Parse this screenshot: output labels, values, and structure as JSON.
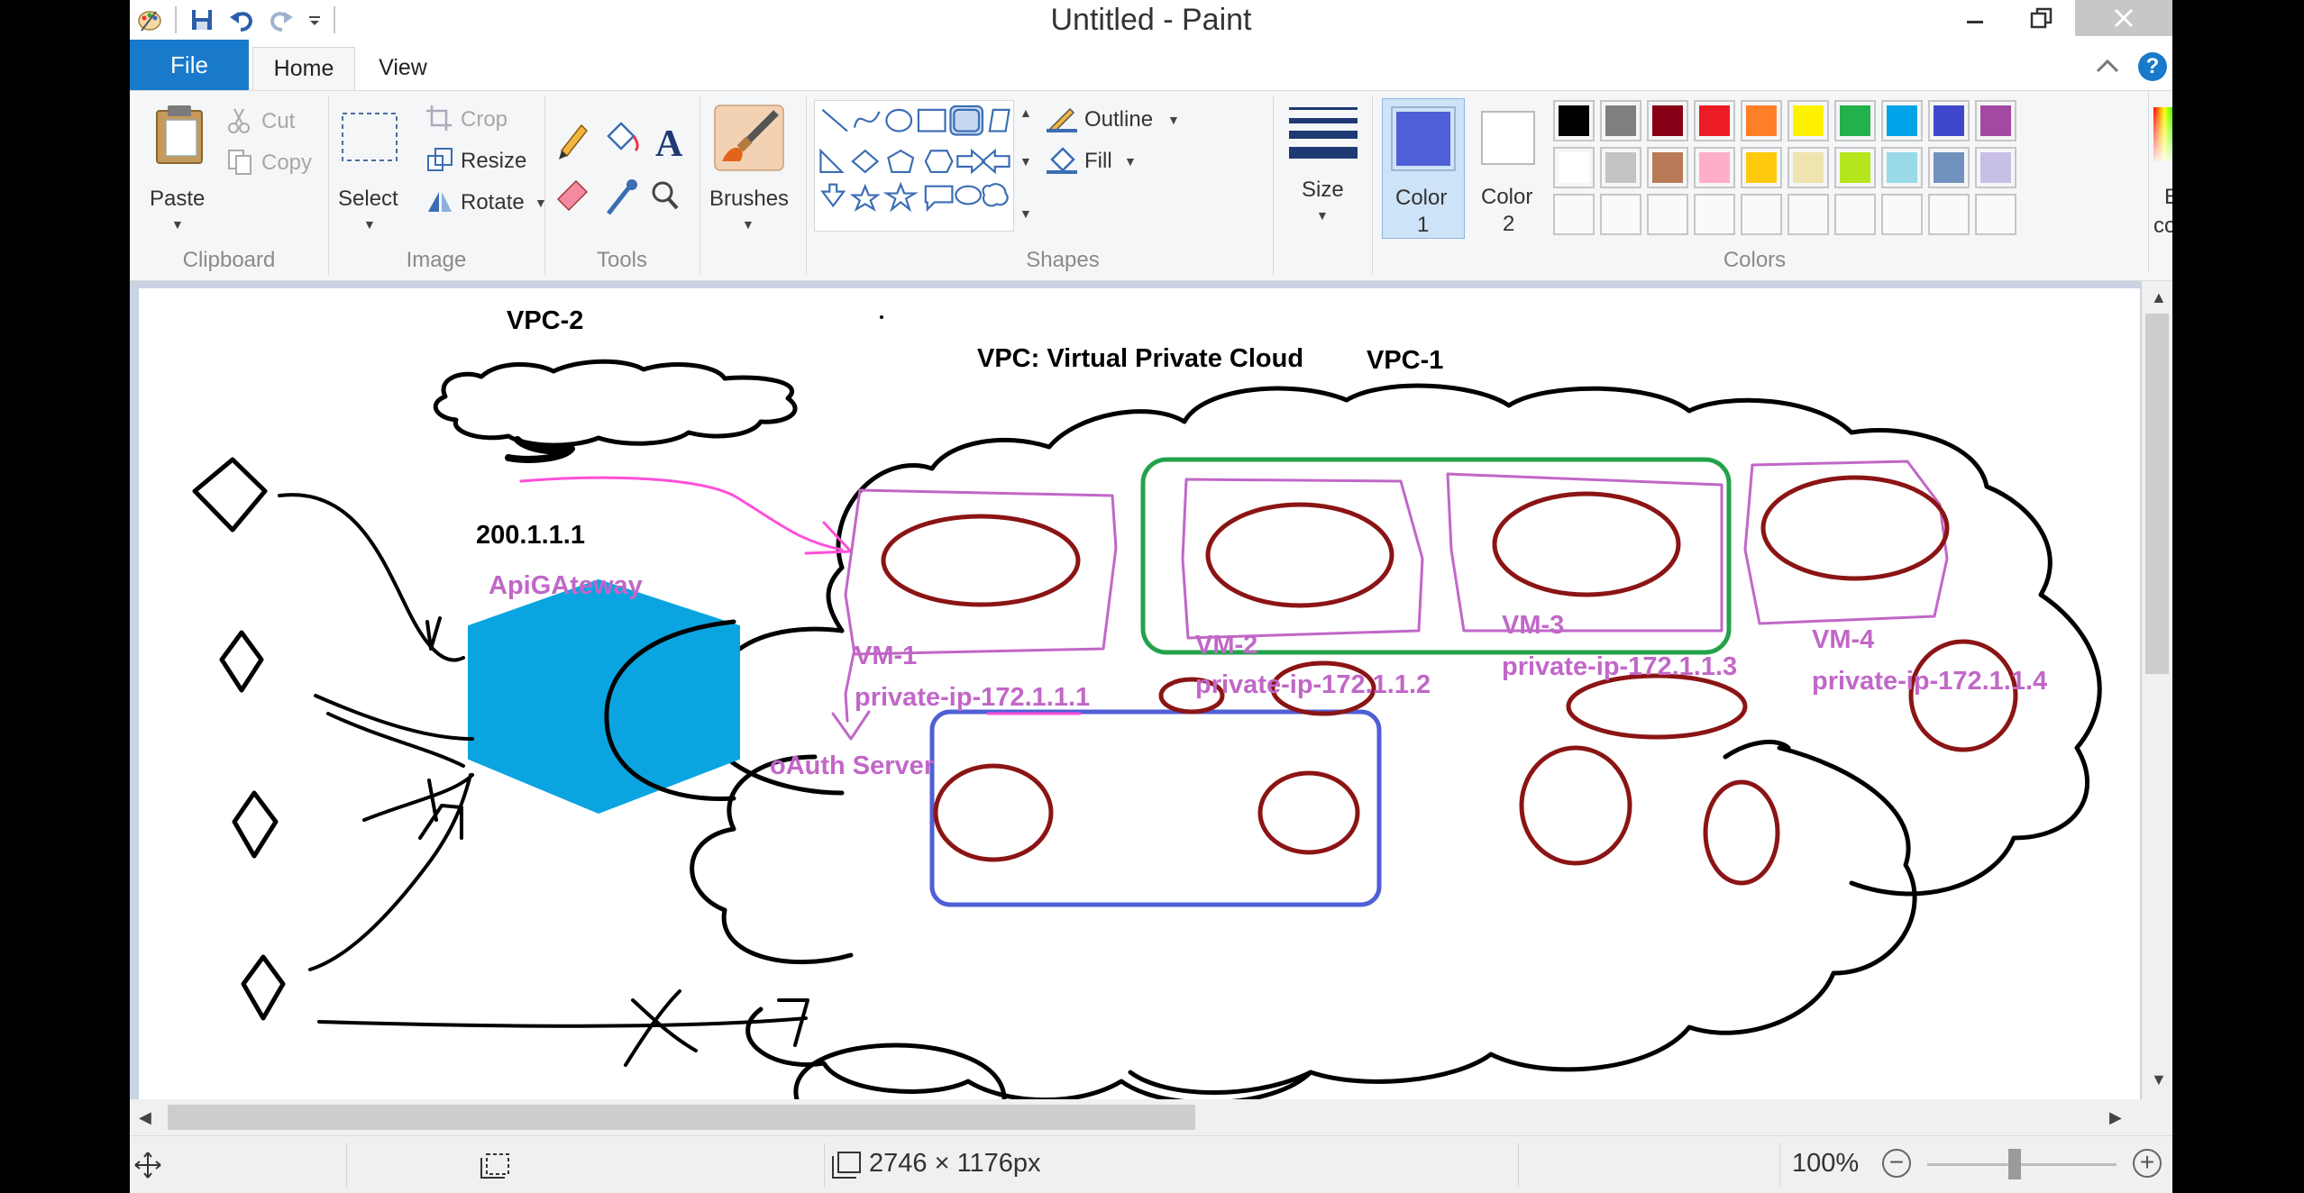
{
  "window": {
    "title": "Untitled - Paint",
    "tabs": [
      {
        "label": "File"
      },
      {
        "label": "Home"
      },
      {
        "label": "View"
      }
    ]
  },
  "ribbon": {
    "clipboard": {
      "paste": "Paste",
      "cut": "Cut",
      "copy": "Copy",
      "group": "Clipboard"
    },
    "image": {
      "select": "Select",
      "crop": "Crop",
      "resize": "Resize",
      "rotate": "Rotate",
      "group": "Image"
    },
    "tools": {
      "group": "Tools"
    },
    "brushes": {
      "label": "Brushes"
    },
    "shapes": {
      "outline": "Outline",
      "fill": "Fill",
      "group": "Shapes"
    },
    "size": {
      "label": "Size"
    },
    "colors": {
      "color1_label": "Color",
      "color1_num": "1",
      "color2_label": "Color",
      "color2_num": "2",
      "edit_label1": "Edit",
      "edit_label2": "colors",
      "group": "Colors",
      "color1": "#4f5fd6",
      "color2": "#ffffff",
      "palette_row1": [
        "#000000",
        "#7f7f7f",
        "#880015",
        "#ed1c24",
        "#ff7f27",
        "#fff200",
        "#22b14c",
        "#00a2e8",
        "#3f48cc",
        "#a349a4"
      ],
      "palette_row2": [
        "#ffffff",
        "#c3c3c3",
        "#b97a57",
        "#ffaec9",
        "#ffc90e",
        "#efe4b0",
        "#b5e61d",
        "#99d9ea",
        "#7092be",
        "#c8bfe7"
      ]
    }
  },
  "canvas": {
    "labels": {
      "vpc2": "VPC-2",
      "vpc_def": "VPC: Virtual Private Cloud",
      "vpc1": "VPC-1",
      "ip": "200.1.1.1",
      "gateway": "ApiGAteway",
      "oauth": "oAuth Server",
      "vm1": "VM-1",
      "vm1_ip": "private-ip-172.1.1.1",
      "vm2": "VM-2",
      "vm2_ip": "private-ip-172.1.1.2",
      "vm3": "VM-3",
      "vm3_ip": "private-ip-172.1.1.3",
      "vm4": "VM-4",
      "vm4_ip": "private-ip-172.1.1.4"
    }
  },
  "status": {
    "dimensions": "2746 × 1176px",
    "zoom": "100%"
  }
}
